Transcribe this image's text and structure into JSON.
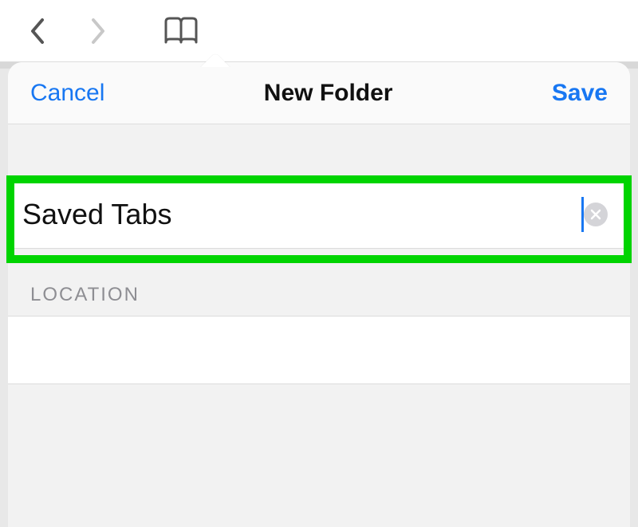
{
  "header": {
    "cancel": "Cancel",
    "title": "New Folder",
    "save": "Save"
  },
  "folder_name": "Saved Tabs",
  "section_label": "LOCATION",
  "icons": {
    "back": "chevron-left",
    "forward": "chevron-right",
    "bookmarks": "book-open",
    "clear": "x"
  },
  "colors": {
    "accent": "#1877f2",
    "highlight": "#00d400"
  }
}
